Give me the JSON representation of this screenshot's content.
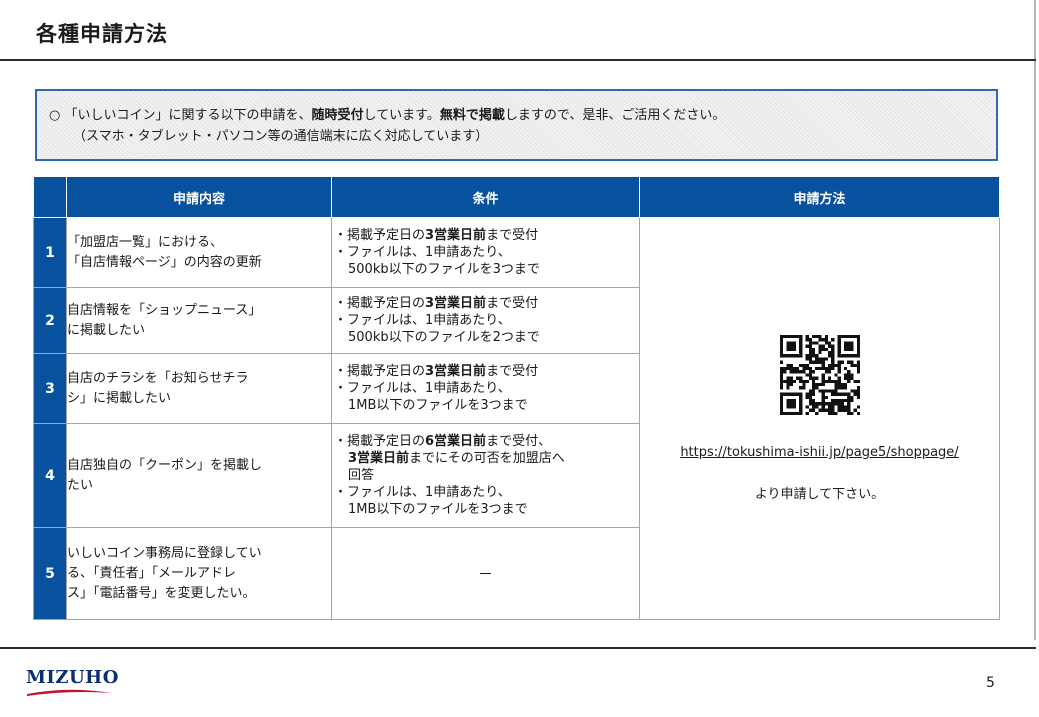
{
  "title": "各種申請方法",
  "notice": {
    "bullet": "○",
    "line1_a": "「いしいコイン」に関する以下の申請を、",
    "line1_b": "随時受付",
    "line1_c": "しています。",
    "line1_d": "無料で掲載",
    "line1_e": "しますので、是非、ご活用ください。",
    "line2": "（スマホ・タブレット・パソコン等の通信端末に広く対応しています）"
  },
  "table": {
    "headers": [
      "申請内容",
      "条件",
      "申請方法"
    ],
    "rows": [
      {
        "no": "1",
        "content": [
          "「加盟店一覧」における、",
          "「自店情報ページ」の内容の更新"
        ],
        "cond": {
          "l1_pre": "・掲載予定日の",
          "l1_bold": "3営業日前",
          "l1_post": "まで受付",
          "l2": "・ファイルは、1申請あたり、",
          "l3": "500kb以下のファイルを3つまで"
        }
      },
      {
        "no": "2",
        "content": [
          "自店情報を「ショップニュース」",
          "に掲載したい"
        ],
        "cond": {
          "l1_pre": "・掲載予定日の",
          "l1_bold": "3営業日前",
          "l1_post": "まで受付",
          "l2": "・ファイルは、1申請あたり、",
          "l3": "500kb以下のファイルを2つまで"
        }
      },
      {
        "no": "3",
        "content": [
          "自店のチラシを「お知らせチラ",
          "シ」に掲載したい"
        ],
        "cond": {
          "l1_pre": "・掲載予定日の",
          "l1_bold": "3営業日前",
          "l1_post": "まで受付",
          "l2": "・ファイルは、1申請あたり、",
          "l3": "1MB以下のファイルを3つまで"
        }
      },
      {
        "no": "4",
        "content": [
          "自店独自の「クーポン」を掲載し",
          "たい"
        ],
        "cond": {
          "l1_pre": "・掲載予定日の",
          "l1_bold": "6営業日前",
          "l1_post": "まで受付、",
          "l2_bold": "3営業日前",
          "l2_post": "までにその可否を加盟店へ",
          "l3": "回答",
          "l4": "・ファイルは、1申請あたり、",
          "l5": "1MB以下のファイルを3つまで"
        }
      },
      {
        "no": "5",
        "content": [
          "いしいコイン事務局に登録してい",
          "る、「責任者」「メールアドレ",
          "ス」「電話番号」を変更したい。"
        ],
        "cond_dash": "－"
      }
    ],
    "method": {
      "qr_icon": "qr-code-icon",
      "url": "https://tokushima-ishii.jp/page5/shoppage/",
      "note": "より申請して下さい。"
    }
  },
  "footer": {
    "logo": "MIZUHO",
    "page": "5"
  },
  "colors": {
    "header_blue": "#08519f",
    "notice_border": "#2e68b5",
    "logo_navy": "#0b2f74",
    "logo_red": "#c8102e"
  }
}
